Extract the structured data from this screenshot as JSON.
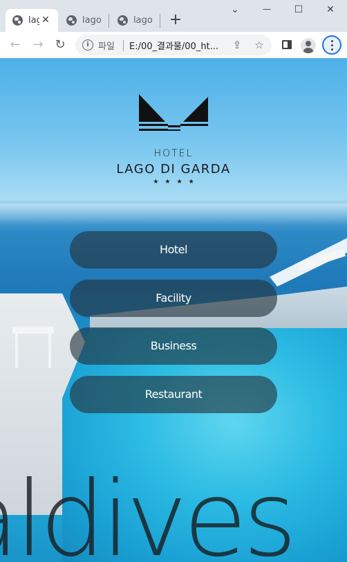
{
  "browser": {
    "tabs": [
      {
        "title": "lago di garda",
        "active": true
      },
      {
        "title": "lago di garda",
        "active": false
      },
      {
        "title": "lago di garda",
        "active": false
      }
    ],
    "new_tab_symbol": "+",
    "window_controls": {
      "dropdown": "⌄",
      "minimize": "—",
      "maximize": "☐",
      "close": "✕"
    },
    "nav": {
      "back": "←",
      "forward": "→",
      "reload": "↻"
    },
    "address": {
      "scheme_label": "파일",
      "url": "E:/00_결과물/00_ht..."
    }
  },
  "page": {
    "logo": {
      "label_top": "HOTEL",
      "name": "LAGO DI GARDA",
      "stars": "★★★★"
    },
    "menu": [
      {
        "label": "Hotel"
      },
      {
        "label": "Facility"
      },
      {
        "label": "Business"
      },
      {
        "label": "Restaurant"
      }
    ],
    "background_word": "aldives"
  },
  "colors": {
    "button_bg": "rgba(35,50,58,0.62)",
    "accent_blue": "#1a73e8",
    "chrome_bg": "#dfe3ea"
  }
}
